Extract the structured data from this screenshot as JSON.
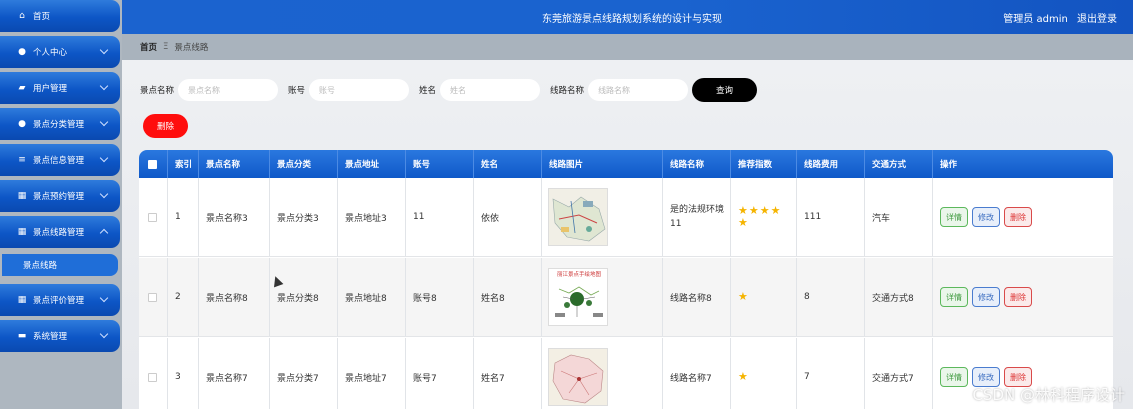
{
  "sidebar": {
    "items": [
      {
        "label": "首页",
        "icon": "home-icon",
        "glyph": "⌂",
        "expanded": false,
        "has_chevron": false
      },
      {
        "label": "个人中心",
        "icon": "user-icon",
        "glyph": "●",
        "expanded": false,
        "has_chevron": true
      },
      {
        "label": "用户管理",
        "icon": "users-icon",
        "glyph": "▰",
        "expanded": false,
        "has_chevron": true
      },
      {
        "label": "景点分类管理",
        "icon": "person-icon",
        "glyph": "●",
        "expanded": false,
        "has_chevron": true
      },
      {
        "label": "景点信息管理",
        "icon": "list-icon",
        "glyph": "≡",
        "expanded": false,
        "has_chevron": true
      },
      {
        "label": "景点预约管理",
        "icon": "grid-icon",
        "glyph": "▦",
        "expanded": false,
        "has_chevron": true
      },
      {
        "label": "景点线路管理",
        "icon": "grid-icon",
        "glyph": "▦",
        "expanded": true,
        "has_chevron": true
      },
      {
        "label": "景点评价管理",
        "icon": "table-icon",
        "glyph": "▦",
        "expanded": false,
        "has_chevron": true
      },
      {
        "label": "系统管理",
        "icon": "monitor-icon",
        "glyph": "▬",
        "expanded": false,
        "has_chevron": true
      }
    ],
    "sub_item": "景点线路"
  },
  "header": {
    "title": "东莞旅游景点线路规划系统的设计与实现",
    "admin": "管理员 admin",
    "logout": "退出登录"
  },
  "breadcrumb": {
    "home": "首页",
    "sep": "Ξ",
    "current": "景点线路"
  },
  "search": {
    "fields": [
      {
        "label": "景点名称",
        "placeholder": "景点名称"
      },
      {
        "label": "账号",
        "placeholder": "账号"
      },
      {
        "label": "姓名",
        "placeholder": "姓名"
      },
      {
        "label": "线路名称",
        "placeholder": "线路名称"
      }
    ],
    "query_label": "查询",
    "delete_label": "删除"
  },
  "table": {
    "columns": [
      "",
      "索引",
      "景点名称",
      "景点分类",
      "景点地址",
      "账号",
      "姓名",
      "线路图片",
      "线路名称",
      "推荐指数",
      "线路费用",
      "交通方式",
      "操作"
    ],
    "rows": [
      {
        "index": "1",
        "name": "景点名称3",
        "category": "景点分类3",
        "address": "景点地址3",
        "account": "11",
        "person": "依依",
        "route_name": "是的法规环境11",
        "rating": 5,
        "fee": "111",
        "transport": "汽车"
      },
      {
        "index": "2",
        "name": "景点名称8",
        "category": "景点分类8",
        "address": "景点地址8",
        "account": "账号8",
        "person": "姓名8",
        "route_name": "线路名称8",
        "rating": 1,
        "fee": "8",
        "transport": "交通方式8"
      },
      {
        "index": "3",
        "name": "景点名称7",
        "category": "景点分类7",
        "address": "景点地址7",
        "account": "账号7",
        "person": "姓名7",
        "route_name": "线路名称7",
        "rating": 1,
        "fee": "7",
        "transport": "交通方式7"
      }
    ],
    "actions": {
      "detail": "详情",
      "edit": "修改",
      "delete": "删除"
    },
    "map_caption": "丽江景点手绘地图"
  },
  "watermark": "CSDN @林科程序设计",
  "colors": {
    "accent": "#0d56c6",
    "danger": "#ff0d0d",
    "star": "#f5b400"
  }
}
